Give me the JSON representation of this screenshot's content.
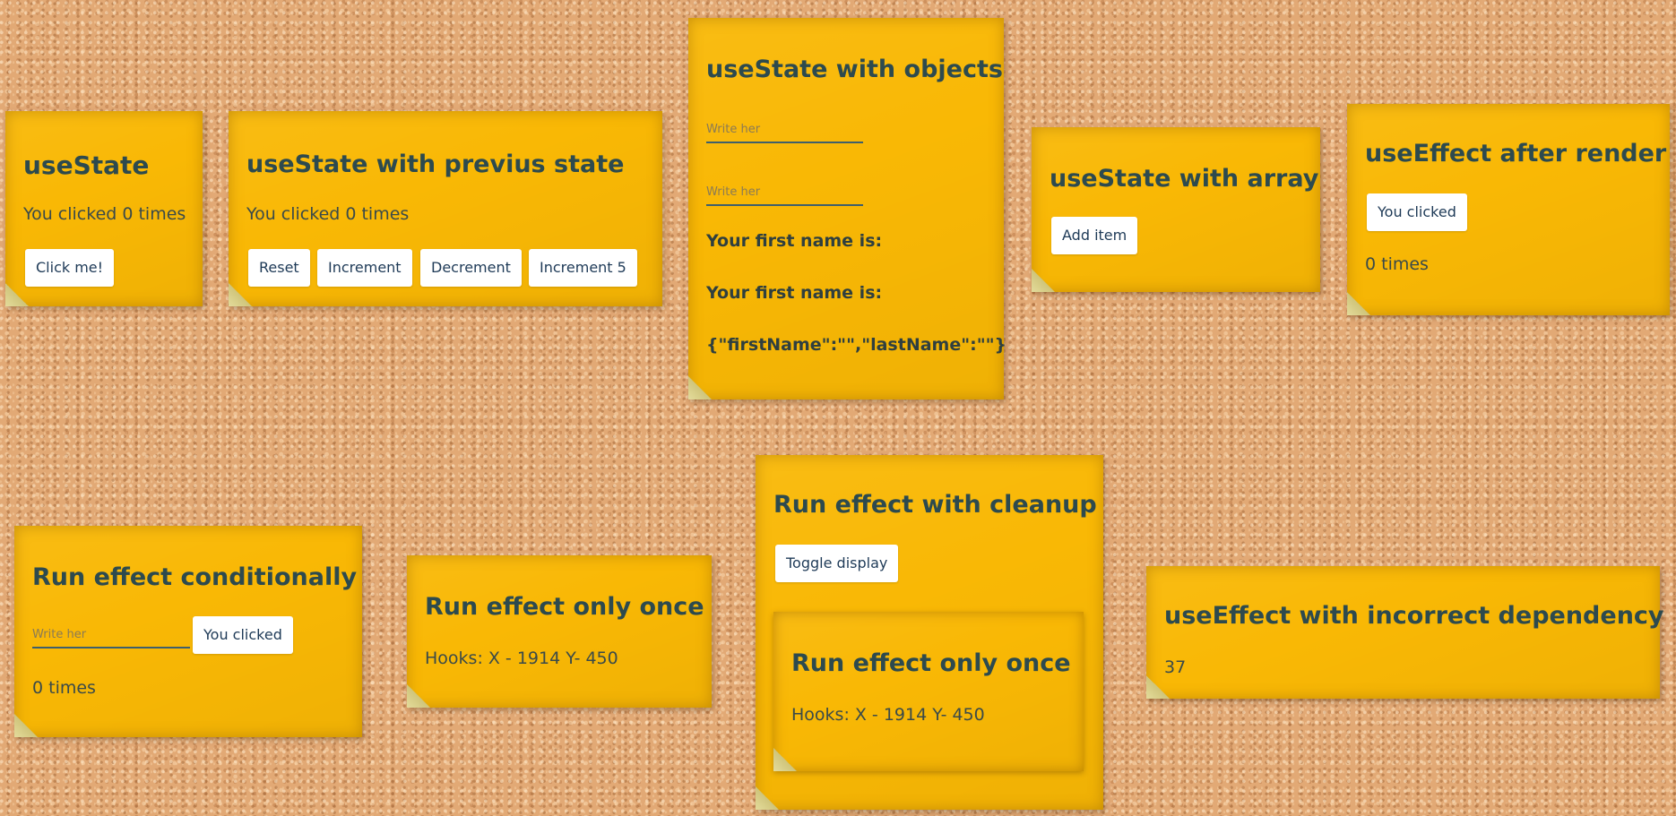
{
  "cards": {
    "use_state": {
      "title": "useState",
      "count_text": "You clicked 0 times",
      "button": "Click me!"
    },
    "prev_state": {
      "title": "useState with previus state",
      "count_text": "You clicked 0 times",
      "buttons": [
        "Reset",
        "Increment",
        "Decrement",
        "Increment 5"
      ]
    },
    "objects": {
      "title": "useState with objects",
      "input1_placeholder": "Write her",
      "input2_placeholder": "Write her",
      "first_name_line1": "Your first name is:",
      "first_name_line2": "Your first name is:",
      "json_text": "{\"firstName\":\"\",\"lastName\":\"\"}"
    },
    "array": {
      "title": "useState with array",
      "button": "Add item"
    },
    "after_render": {
      "title": "useEffect after render",
      "button": "You clicked",
      "count_text": "0 times"
    },
    "conditionally": {
      "title": "Run effect conditionally",
      "input_placeholder": "Write her",
      "button": "You clicked",
      "count_text": "0 times"
    },
    "only_once": {
      "title": "Run effect only once",
      "hooks_text": "Hooks: X - 1914 Y- 450"
    },
    "cleanup": {
      "title": "Run effect with cleanup",
      "button": "Toggle display",
      "inner_title": "Run effect only once",
      "inner_hooks_text": "Hooks: X - 1914 Y- 450"
    },
    "incorrect_dep": {
      "title": "useEffect with incorrect dependency",
      "value": "37"
    }
  },
  "colors": {
    "note": "#f9b805",
    "title_text": "#2d4a4e",
    "button_bg": "#ffffff",
    "button_text": "#1e3a57",
    "cork": "#e2a975"
  }
}
